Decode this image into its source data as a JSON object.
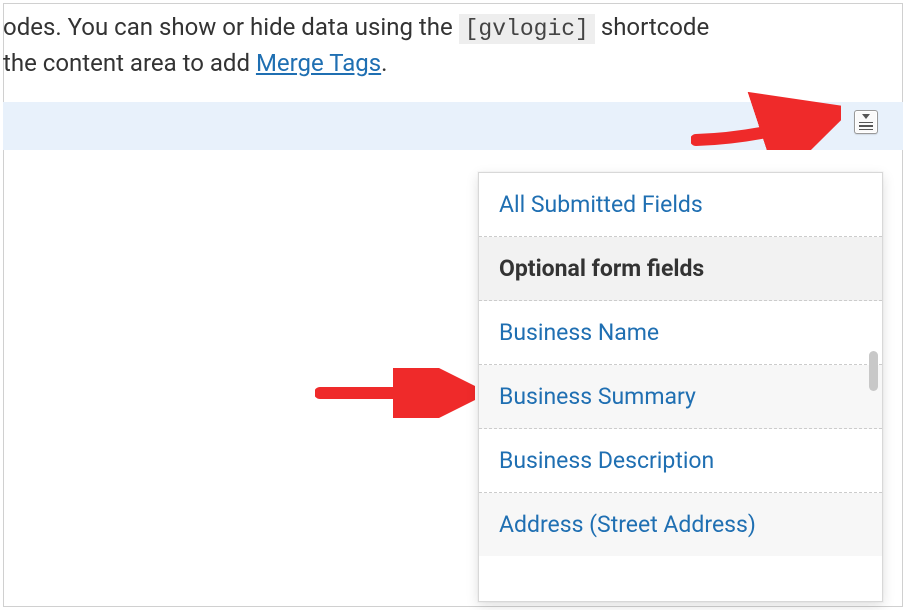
{
  "help": {
    "line1_pre": "odes. You can show or hide data using the ",
    "code": "[gvlogic]",
    "line1_post": " shortcode",
    "line2_pre": "the content area to add ",
    "link": "Merge Tags",
    "line2_post": "."
  },
  "icon_name": "merge-tags-icon",
  "dropdown": {
    "items": [
      {
        "label": "All Submitted Fields",
        "type": "item",
        "alt": false
      },
      {
        "label": "Optional form fields",
        "type": "header"
      },
      {
        "label": "Business Name",
        "type": "item",
        "alt": false
      },
      {
        "label": "Business Summary",
        "type": "item",
        "alt": true
      },
      {
        "label": "Business Description",
        "type": "item",
        "alt": false
      },
      {
        "label": "Address (Street Address)",
        "type": "item",
        "alt": true
      }
    ]
  }
}
